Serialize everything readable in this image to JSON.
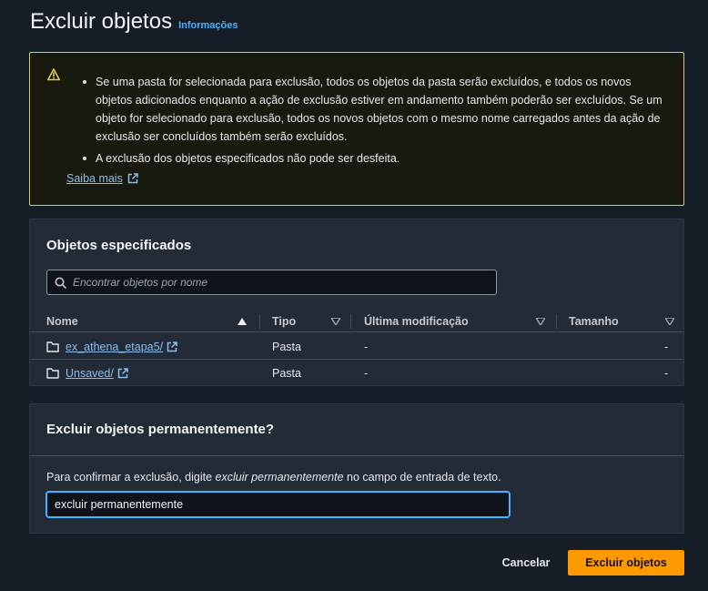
{
  "header": {
    "title": "Excluir objetos",
    "info_link": "Informações"
  },
  "alert": {
    "items": [
      "Se uma pasta for selecionada para exclusão, todos os objetos da pasta serão excluídos, e todos os novos objetos adicionados enquanto a ação de exclusão estiver em andamento também poderão ser excluídos. Se um objeto for selecionado para exclusão, todos os novos objetos com o mesmo nome carregados antes da ação de exclusão ser concluídos também serão excluídos.",
      "A exclusão dos objetos especificados não pode ser desfeita."
    ],
    "learn_more": "Saiba mais",
    "icon": "warning-icon"
  },
  "objects_panel": {
    "title": "Objetos especificados",
    "search": {
      "placeholder": "Encontrar objetos por nome",
      "value": ""
    },
    "columns": [
      "Nome",
      "Tipo",
      "Última modificação",
      "Tamanho"
    ],
    "rows": [
      {
        "name": "ex_athena_etapa5/",
        "type": "Pasta",
        "modified": "-",
        "size": "-"
      },
      {
        "name": "Unsaved/",
        "type": "Pasta",
        "modified": "-",
        "size": "-"
      }
    ]
  },
  "confirm_panel": {
    "title": "Excluir objetos permanentemente?",
    "desc_before": "Para confirmar a exclusão, digite ",
    "desc_phrase": "excluir permanentemente",
    "desc_after": " no campo de entrada de texto.",
    "input_value": "excluir permanentemente"
  },
  "actions": {
    "cancel": "Cancelar",
    "delete": "Excluir objetos"
  },
  "colors": {
    "accent": "#42b4ff",
    "primary_button": "#ff9900",
    "warning_border": "#e0ca57",
    "link": "#89bdee"
  }
}
